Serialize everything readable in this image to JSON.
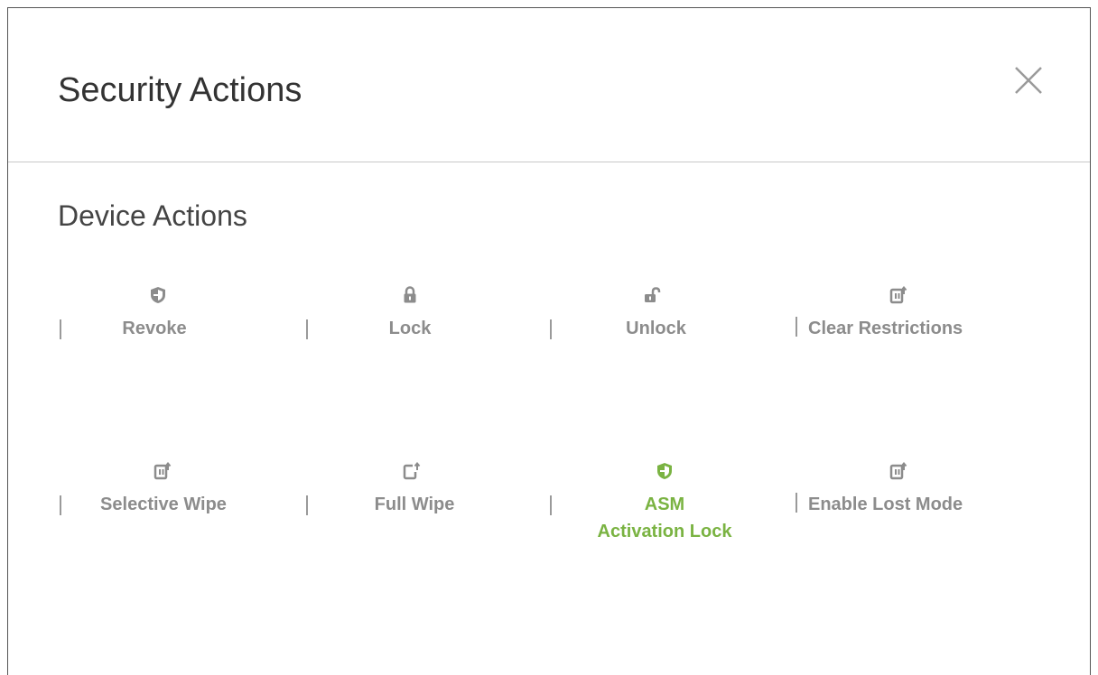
{
  "modal": {
    "title": "Security Actions",
    "section_title": "Device Actions"
  },
  "actions": [
    {
      "label": "Revoke",
      "icon": "shield-icon",
      "active": false
    },
    {
      "label": "Lock",
      "icon": "lock-icon",
      "active": false
    },
    {
      "label": "Unlock",
      "icon": "unlock-icon",
      "active": false
    },
    {
      "label": "Clear Restrictions",
      "icon": "device-export-icon",
      "active": false
    },
    {
      "label": "Selective Wipe",
      "icon": "device-export-icon",
      "active": false
    },
    {
      "label": "Full Wipe",
      "icon": "device-outline-export-icon",
      "active": false
    },
    {
      "label_line1": "ASM",
      "label_line2": "Activation Lock",
      "icon": "shield-icon",
      "active": true
    },
    {
      "label": "Enable Lost Mode",
      "icon": "device-export-icon",
      "active": false
    }
  ],
  "colors": {
    "inactive": "#8c8c8c",
    "active": "#7ab342",
    "title": "#333333"
  }
}
